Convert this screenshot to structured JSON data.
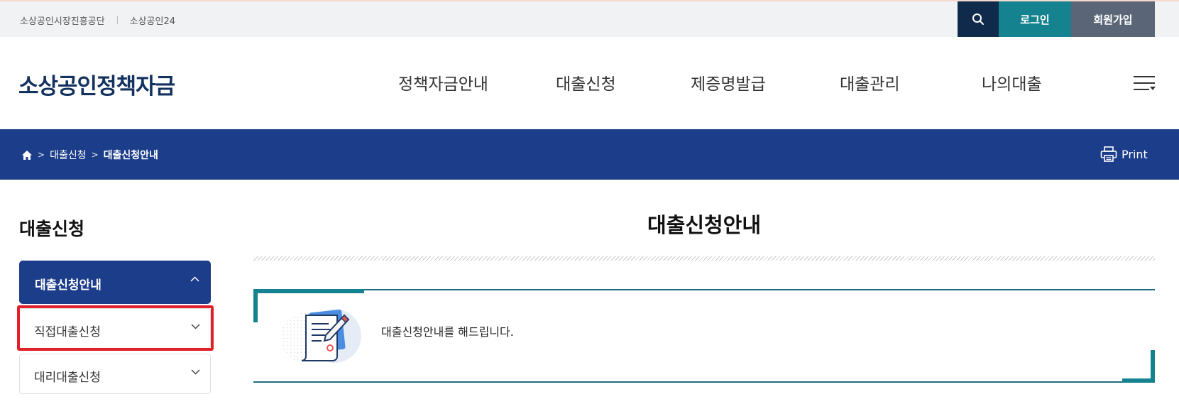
{
  "util": {
    "links": [
      "소상공인시장진흥공단",
      "소상공인24"
    ],
    "login_label": "로그인",
    "join_label": "회원가입"
  },
  "header": {
    "logo": "소상공인정책자금",
    "nav": [
      "정책자금안내",
      "대출신청",
      "제증명발급",
      "대출관리",
      "나의대출"
    ]
  },
  "breadcrumb": {
    "items": [
      "대출신청",
      "대출신청안내"
    ],
    "print_label": "Print"
  },
  "sidebar": {
    "title": "대출신청",
    "active": "대출신청안내",
    "items": [
      "직접대출신청",
      "대리대출신청"
    ]
  },
  "content": {
    "title": "대출신청안내",
    "info_text": "대출신청안내를 해드립니다."
  },
  "colors": {
    "navy": "#1c3d8a",
    "teal": "#14838f",
    "highlight": "#e0202a"
  }
}
